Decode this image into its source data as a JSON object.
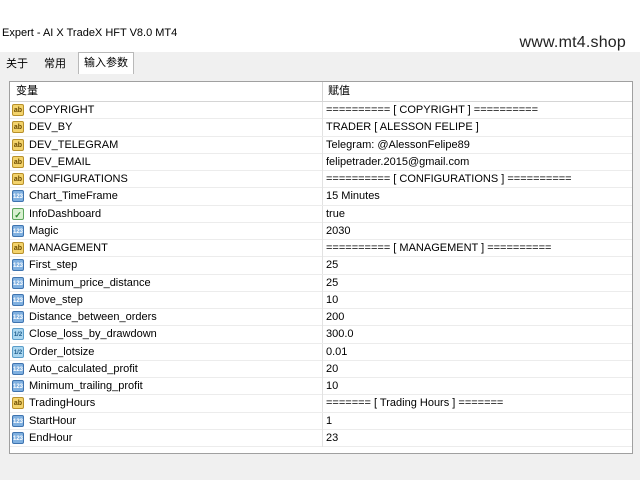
{
  "window": {
    "title": "Expert - AI X TradeX HFT  V8.0 MT4",
    "watermark": "www.mt4.shop"
  },
  "tabs": [
    {
      "label": "关于",
      "active": false
    },
    {
      "label": "常用",
      "active": false
    },
    {
      "label": "输入参数",
      "active": true
    }
  ],
  "table": {
    "headers": {
      "variable": "变量",
      "value": "赋值"
    },
    "rows": [
      {
        "icon": "string-icon",
        "name": "COPYRIGHT",
        "value": "========== [ COPYRIGHT ] =========="
      },
      {
        "icon": "string-icon",
        "name": "DEV_BY",
        "value": "TRADER [ ALESSON FELIPE ]"
      },
      {
        "icon": "string-icon",
        "name": "DEV_TELEGRAM",
        "value": "Telegram: @AlessonFelipe89"
      },
      {
        "icon": "string-icon",
        "name": "DEV_EMAIL",
        "value": "felipetrader.2015@gmail.com"
      },
      {
        "icon": "string-icon",
        "name": "CONFIGURATIONS",
        "value": "========== [ CONFIGURATIONS ] =========="
      },
      {
        "icon": "integer-icon",
        "name": "Chart_TimeFrame",
        "value": "15 Minutes"
      },
      {
        "icon": "bool-icon",
        "name": "InfoDashboard",
        "value": "true"
      },
      {
        "icon": "integer-icon",
        "name": "Magic",
        "value": "2030"
      },
      {
        "icon": "string-icon",
        "name": "MANAGEMENT",
        "value": "========== [ MANAGEMENT ] =========="
      },
      {
        "icon": "integer-icon",
        "name": "First_step",
        "value": "25"
      },
      {
        "icon": "integer-icon",
        "name": "Minimum_price_distance",
        "value": "25"
      },
      {
        "icon": "integer-icon",
        "name": "Move_step",
        "value": "10"
      },
      {
        "icon": "integer-icon",
        "name": "Distance_between_orders",
        "value": "200"
      },
      {
        "icon": "double-icon",
        "name": "Close_loss_by_drawdown",
        "value": "300.0"
      },
      {
        "icon": "double-icon",
        "name": "Order_lotsize",
        "value": "0.01"
      },
      {
        "icon": "integer-icon",
        "name": "Auto_calculated_profit",
        "value": "20"
      },
      {
        "icon": "integer-icon",
        "name": "Minimum_trailing_profit",
        "value": "10"
      },
      {
        "icon": "string-icon",
        "name": "TradingHours",
        "value": "======= [ Trading Hours ] ======="
      },
      {
        "icon": "integer-icon",
        "name": "StartHour",
        "value": "1"
      },
      {
        "icon": "integer-icon",
        "name": "EndHour",
        "value": "23"
      }
    ]
  }
}
